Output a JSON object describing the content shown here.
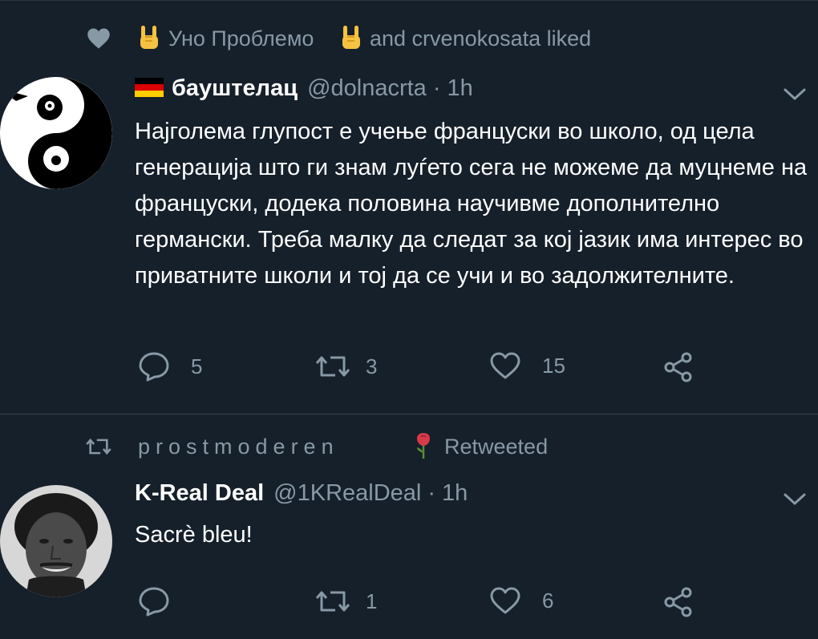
{
  "tweets": [
    {
      "social_context": {
        "type": "liked",
        "user1": "Уно Проблемо",
        "user2": "and crvenokosata liked"
      },
      "author": {
        "flag": "de",
        "name": "бауштелац",
        "handle": "@dolnacrta",
        "time": "1h"
      },
      "text": "Најголема глупост е учење француски во школо, од цела генерација што ги знам луѓето сега не можеме да муцнеме на француски, додека половина научивме дополнително германски. Треба малку да следат за кој јазик има интерес во приватните школи и тој да се учи и во задолжителните.",
      "counts": {
        "reply": "5",
        "retweet": "3",
        "like": "15"
      }
    },
    {
      "social_context": {
        "type": "retweeted",
        "user": "prostmoderen",
        "label": "Retweeted"
      },
      "author": {
        "name": "K-Real Deal",
        "handle": "@1KRealDeal",
        "time": "1h"
      },
      "text": "Sacrè bleu!",
      "counts": {
        "reply": "",
        "retweet": "1",
        "like": "6"
      }
    }
  ],
  "separator": "·",
  "colors": {
    "background": "#15202b",
    "secondary_text": "#8899a6",
    "divider": "#38444d"
  }
}
